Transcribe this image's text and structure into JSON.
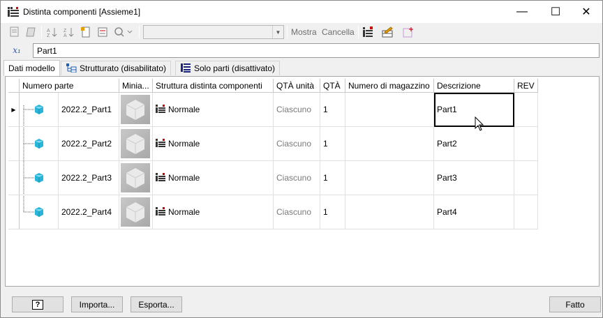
{
  "window": {
    "title": "Distinta componenti [Assieme1]",
    "minimize_glyph": "—",
    "maximize_glyph": "☐",
    "close_glyph": "✕"
  },
  "toolbar": {
    "view_label": "Mostra",
    "delete_label": "Cancella",
    "combo_value": ""
  },
  "formula": {
    "fx_label": "x₁",
    "value": "Part1"
  },
  "tabs": [
    {
      "label": "Dati modello"
    },
    {
      "label": "Strutturato (disabilitato)"
    },
    {
      "label": "Solo parti (disattivato)"
    }
  ],
  "grid": {
    "columns": [
      "Numero parte",
      "Minia...",
      "Struttura distinta componenti",
      "QTÀ unità",
      "QTÀ",
      "Numero di magazzino",
      "Descrizione",
      "REV"
    ],
    "rows": [
      {
        "part_number": "2022.2_Part1",
        "structure": "Normale",
        "unit_qty": "Ciascuno",
        "qty": "1",
        "stock_number": "",
        "description": "Part1",
        "rev": ""
      },
      {
        "part_number": "2022.2_Part2",
        "structure": "Normale",
        "unit_qty": "Ciascuno",
        "qty": "1",
        "stock_number": "",
        "description": "Part2",
        "rev": ""
      },
      {
        "part_number": "2022.2_Part3",
        "structure": "Normale",
        "unit_qty": "Ciascuno",
        "qty": "1",
        "stock_number": "",
        "description": "Part3",
        "rev": ""
      },
      {
        "part_number": "2022.2_Part4",
        "structure": "Normale",
        "unit_qty": "Ciascuno",
        "qty": "1",
        "stock_number": "",
        "description": "Part4",
        "rev": ""
      }
    ]
  },
  "footer": {
    "help_label": "?",
    "import_label": "Importa...",
    "export_label": "Esporta...",
    "done_label": "Fatto"
  }
}
